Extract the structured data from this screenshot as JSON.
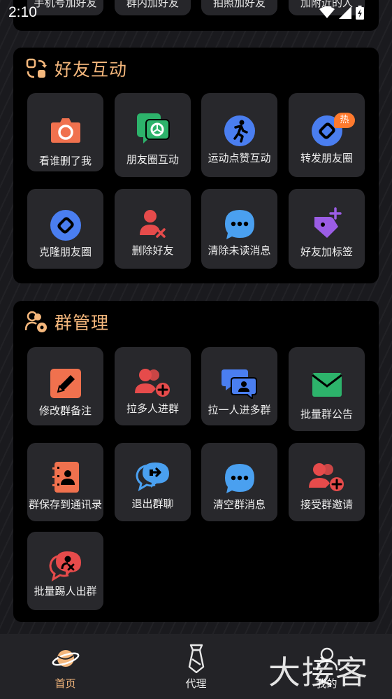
{
  "status_bar": {
    "time": "2:10"
  },
  "top_section": {
    "items": [
      "手机号加好友",
      "群内加好友",
      "拍照加好友",
      "加附近的人"
    ]
  },
  "friend_interaction": {
    "title": "好友互动",
    "items": [
      {
        "label": "看谁删了我",
        "icon": "camera-icon",
        "color": "#f0714e"
      },
      {
        "label": "朋友圈互动",
        "icon": "moments-icon",
        "color": "#2db36b"
      },
      {
        "label": "运动点赞互动",
        "icon": "running-icon",
        "color": "#4a7ef0"
      },
      {
        "label": "转发朋友圈",
        "icon": "link-icon",
        "color": "#4a7ef0",
        "badge": "热"
      },
      {
        "label": "克隆朋友圈",
        "icon": "link-icon",
        "color": "#4a7ef0"
      },
      {
        "label": "删除好友",
        "icon": "delete-user-icon",
        "color": "#e64b4b"
      },
      {
        "label": "清除未读消息",
        "icon": "chat-bubble-icon",
        "color": "#4aa0f0"
      },
      {
        "label": "好友加标签",
        "icon": "tag-plus-icon",
        "color": "#9b5de5"
      }
    ]
  },
  "group_management": {
    "title": "群管理",
    "items": [
      {
        "label": "修改群备注",
        "icon": "edit-icon",
        "color": "#f0714e"
      },
      {
        "label": "拉多人进群",
        "icon": "add-users-icon",
        "color": "#e64b4b"
      },
      {
        "label": "拉一人进多群",
        "icon": "group-chat-icon",
        "color": "#4a7ef0"
      },
      {
        "label": "批量群公告",
        "icon": "envelope-icon",
        "color": "#2db36b"
      },
      {
        "label": "群保存到通讯录",
        "icon": "contacts-book-icon",
        "color": "#f0714e"
      },
      {
        "label": "退出群聊",
        "icon": "exit-chat-icon",
        "color": "#4aa0f0"
      },
      {
        "label": "清空群消息",
        "icon": "chat-bubble-icon",
        "color": "#4aa0f0"
      },
      {
        "label": "接受群邀请",
        "icon": "accept-invite-icon",
        "color": "#e64b4b"
      },
      {
        "label": "批量踢人出群",
        "icon": "kick-user-icon",
        "color": "#e64b4b"
      }
    ]
  },
  "bottom_nav": {
    "items": [
      {
        "label": "首页",
        "icon": "planet-icon",
        "active": true
      },
      {
        "label": "代理",
        "icon": "tie-icon",
        "active": false
      },
      {
        "label": "我的",
        "icon": "user-icon",
        "active": false
      }
    ]
  },
  "watermark": "大接客",
  "colors": {
    "accent": "#f5b77c",
    "active_nav": "#f5b77c",
    "tile_bg": "#28282c",
    "card_bg": "#000000"
  }
}
